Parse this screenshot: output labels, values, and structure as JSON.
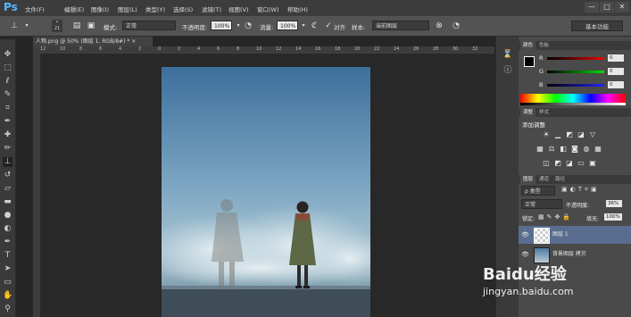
{
  "menubar": {
    "logo": "Ps",
    "items": [
      "文件(F)",
      "编辑(E)",
      "图像(I)",
      "图层(L)",
      "类型(Y)",
      "选择(S)",
      "滤镜(T)",
      "视图(V)",
      "窗口(W)",
      "帮助(H)"
    ],
    "window_controls": [
      "—",
      "□",
      "✕"
    ]
  },
  "options": {
    "mode_label": "模式:",
    "mode_value": "正常",
    "opacity_label": "不透明度:",
    "opacity_value": "100%",
    "flow_label": "流量:",
    "flow_value": "100%",
    "aligned_label": "对齐",
    "sample_label": "样本:",
    "sample_value": "当前图层",
    "brush_size": "21",
    "workspace": "基本功能"
  },
  "document": {
    "tab_title": "人物.png @ 50% (图层 1, RGB/8#) * ×",
    "ruler_ticks": [
      "12",
      "10",
      "8",
      "6",
      "4",
      "2",
      "0",
      "2",
      "4",
      "6",
      "8",
      "10",
      "12",
      "14",
      "16",
      "18",
      "20",
      "22",
      "24",
      "26",
      "28",
      "30",
      "32"
    ]
  },
  "panels": {
    "color_tabs": [
      "颜色",
      "色板"
    ],
    "r_label": "R",
    "g_label": "G",
    "b_label": "B",
    "r_value": "0",
    "g_value": "0",
    "b_value": "0",
    "adjust_tabs": [
      "调整",
      "样式"
    ],
    "adjust_title": "添加调整",
    "layers_tabs": [
      "图层",
      "通道",
      "路径"
    ],
    "kind_label": "ρ 类型",
    "blend_mode": "正常",
    "opacity_label": "不透明度:",
    "opacity_value": "36%",
    "lock_label": "锁定:",
    "fill_label": "填充:",
    "fill_value": "100%",
    "layers": [
      {
        "name": "图层 1"
      },
      {
        "name": "背景图层 拷贝"
      }
    ]
  },
  "watermark": {
    "brand": "Baidu经验",
    "url": "jingyan.baidu.com"
  },
  "colors": {
    "accent": "#5ab6ff",
    "panel": "#4a4a4a",
    "selected_layer": "#596e8f"
  }
}
